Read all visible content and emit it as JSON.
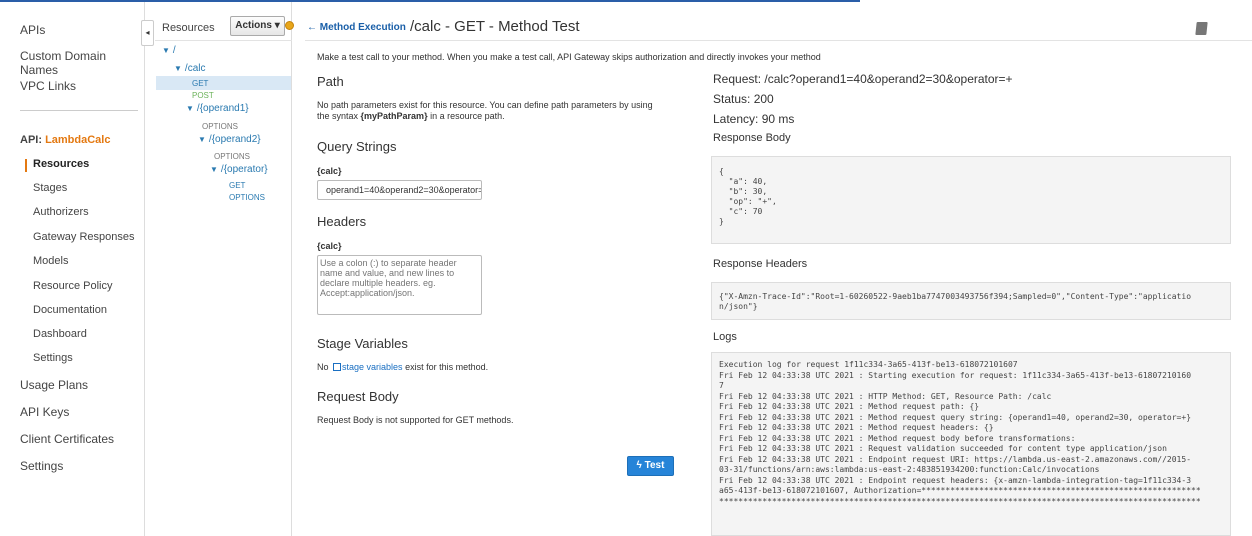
{
  "leftnav": {
    "top_items": [
      "APIs",
      "Custom Domain Names",
      "VPC Links"
    ],
    "api_prefix": "API:",
    "api_name": "LambdaCalc",
    "sub_items": [
      "Resources",
      "Stages",
      "Authorizers",
      "Gateway Responses",
      "Models",
      "Resource Policy",
      "Documentation",
      "Dashboard",
      "Settings"
    ],
    "bottom_items": [
      "Usage Plans",
      "API Keys",
      "Client Certificates",
      "Settings"
    ]
  },
  "tree": {
    "header": "Resources",
    "actions_label": "Actions",
    "nodes": {
      "root": "/",
      "calc": "/calc",
      "calc_get": "GET",
      "calc_post": "POST",
      "operand1": "/{operand1}",
      "operand1_options": "OPTIONS",
      "operand2": "/{operand2}",
      "operand2_options": "OPTIONS",
      "operator": "/{operator}",
      "operator_get": "GET",
      "operator_options": "OPTIONS"
    }
  },
  "header": {
    "back_label": "Method Execution",
    "title": "/calc - GET - Method Test"
  },
  "main": {
    "intro": "Make a test call to your method. When you make a test call, API Gateway skips authorization and directly invokes your method",
    "path_heading": "Path",
    "path_text_1": "No path parameters exist for this resource. You can define path parameters by using",
    "path_text_2_pre": "the syntax ",
    "path_text_2_bold": "{myPathParam}",
    "path_text_2_post": " in a resource path.",
    "query_heading": "Query Strings",
    "query_label": "{calc}",
    "query_value": "operand1=40&operand2=30&operator=+",
    "headers_heading": "Headers",
    "headers_label": "{calc}",
    "headers_placeholder": "Use a colon (:) to separate header name and value, and new lines to declare multiple headers. eg. Accept:application/json.",
    "stage_heading": "Stage Variables",
    "stage_pre": "No ",
    "stage_link": "stage variables",
    "stage_post": " exist for this method.",
    "body_heading": "Request Body",
    "body_text": "Request Body is not supported for GET methods.",
    "test_label": "Test"
  },
  "response": {
    "request": "Request: /calc?operand1=40&operand2=30&operator=+",
    "status": "Status: 200",
    "latency": "Latency: 90 ms",
    "body_heading": "Response Body",
    "body": "{\n  \"a\": 40,\n  \"b\": 30,\n  \"op\": \"+\",\n  \"c\": 70\n}",
    "headers_heading": "Response Headers",
    "headers": "{\"X-Amzn-Trace-Id\":\"Root=1-60260522-9aeb1ba7747003493756f394;Sampled=0\",\"Content-Type\":\"applicatio\nn/json\"}",
    "logs_heading": "Logs",
    "logs": [
      "Execution log for request 1f11c334-3a65-413f-be13-618072101607",
      "Fri Feb 12 04:33:38 UTC 2021 : Starting execution for request: 1f11c334-3a65-413f-be13-61807210160",
      "7",
      "Fri Feb 12 04:33:38 UTC 2021 : HTTP Method: GET, Resource Path: /calc",
      "Fri Feb 12 04:33:38 UTC 2021 : Method request path: {}",
      "Fri Feb 12 04:33:38 UTC 2021 : Method request query string: {operand1=40, operand2=30, operator=+}",
      "Fri Feb 12 04:33:38 UTC 2021 : Method request headers: {}",
      "Fri Feb 12 04:33:38 UTC 2021 : Method request body before transformations:",
      "Fri Feb 12 04:33:38 UTC 2021 : Request validation succeeded for content type application/json",
      "Fri Feb 12 04:33:38 UTC 2021 : Endpoint request URI: https://lambda.us-east-2.amazonaws.com//2015-",
      "03-31/functions/arn:aws:lambda:us-east-2:483851934200:function:Calc/invocations",
      "Fri Feb 12 04:33:38 UTC 2021 : Endpoint request headers: {x-amzn-lambda-integration-tag=1f11c334-3",
      "a65-413f-be13-618072101607, Authorization=**********************************************************",
      "****************************************************************************************************"
    ]
  }
}
